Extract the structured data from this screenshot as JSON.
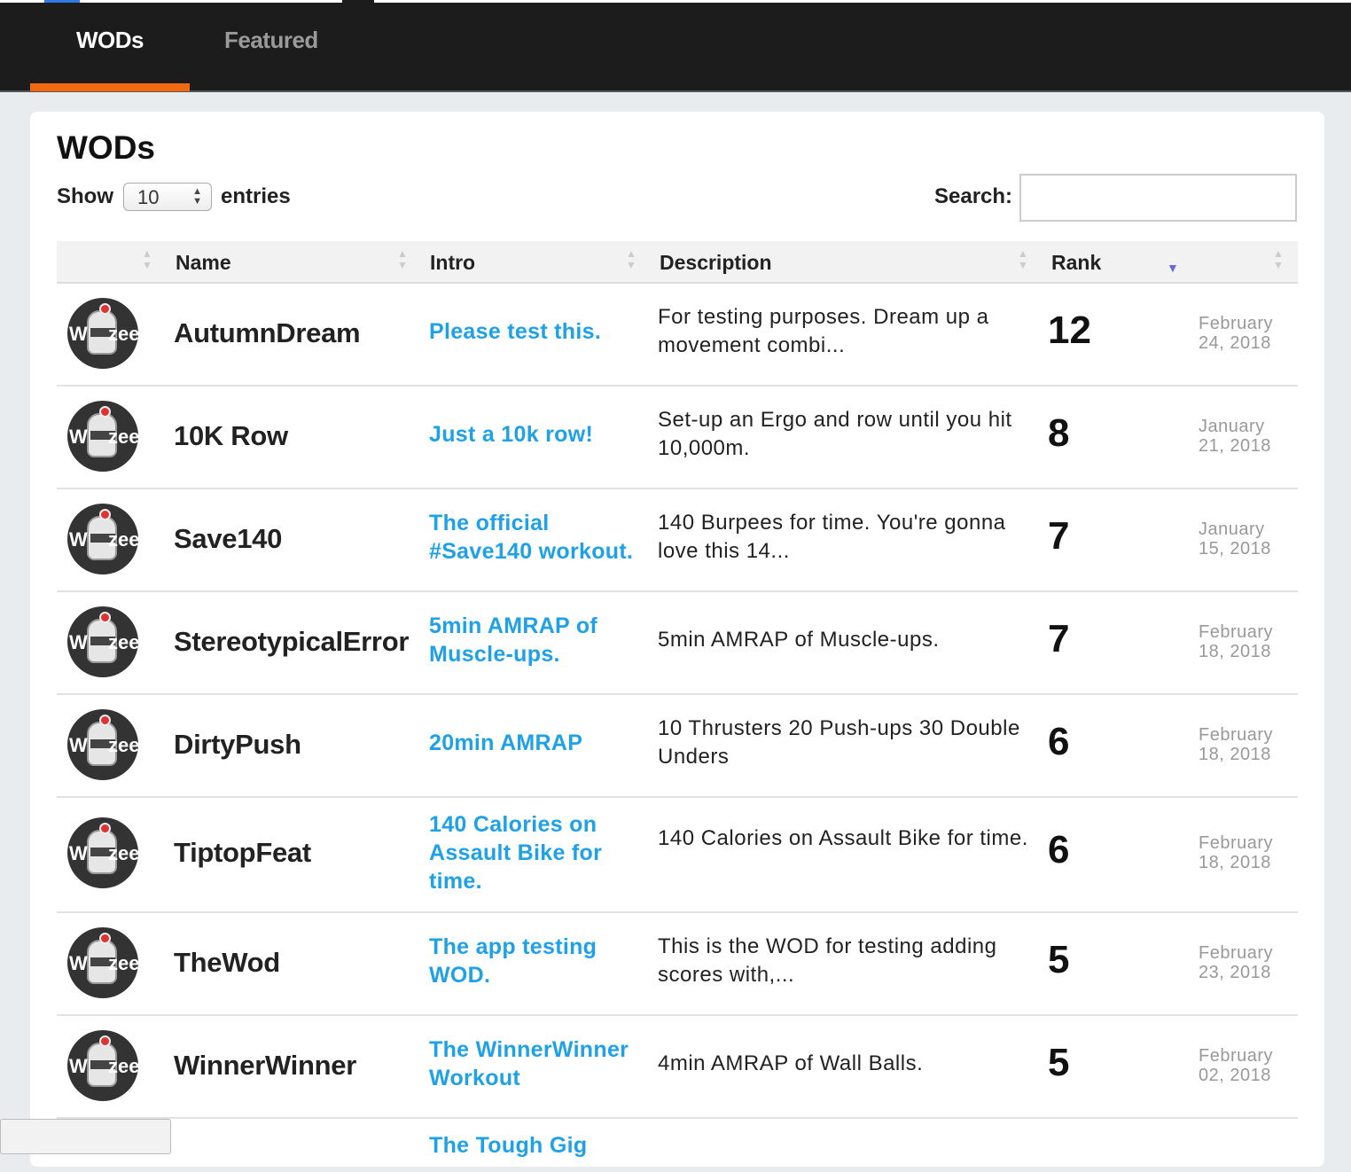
{
  "nav": {
    "tabs": [
      {
        "label": "WODs",
        "active": true
      },
      {
        "label": "Featured",
        "active": false
      }
    ],
    "accent_color": "#f26a10"
  },
  "card": {
    "title": "WODs",
    "length": {
      "show_label": "Show",
      "value": "10",
      "entries_label": "entries"
    },
    "search": {
      "label": "Search:",
      "value": ""
    }
  },
  "table": {
    "columns": [
      "",
      "Name",
      "Intro",
      "Description",
      "Rank",
      ""
    ],
    "sorted_column": "Rank",
    "sort_direction": "descending",
    "rows": [
      {
        "avatar": "robot-avatar",
        "name": "AutumnDream",
        "intro": "Please test this.",
        "description": "For testing purposes. Dream up a movement combi...",
        "rank": "12",
        "date": "February 24, 2018"
      },
      {
        "avatar": "robot-avatar",
        "name": "10K Row",
        "intro": "Just a 10k row!",
        "description": "Set-up an Ergo and row until you hit 10,000m.",
        "rank": "8",
        "date": "January 21, 2018"
      },
      {
        "avatar": "robot-avatar",
        "name": "Save140",
        "intro": "The official #Save140 workout.",
        "description": "140 Burpees for time. You're gonna love this 14...",
        "rank": "7",
        "date": "January 15, 2018"
      },
      {
        "avatar": "robot-avatar",
        "name": "StereotypicalError",
        "intro": "5min AMRAP of Muscle-ups.",
        "description": "5min AMRAP of Muscle-ups.",
        "rank": "7",
        "date": "February 18, 2018"
      },
      {
        "avatar": "robot-avatar",
        "name": "DirtyPush",
        "intro": "20min AMRAP",
        "description": "10 Thrusters 20 Push-ups 30 Double Unders",
        "rank": "6",
        "date": "February 18, 2018"
      },
      {
        "avatar": "robot-avatar",
        "name": "TiptopFeat",
        "intro": "140 Calories on Assault Bike for time.",
        "description": "140 Calories on Assault Bike for time.",
        "rank": "6",
        "date": "February 18, 2018"
      },
      {
        "avatar": "robot-avatar",
        "name": "TheWod",
        "intro": "The app testing WOD.",
        "description": "This is the WOD for testing adding scores with,...",
        "rank": "5",
        "date": "February 23, 2018"
      },
      {
        "avatar": "robot-avatar",
        "name": "WinnerWinner",
        "intro": "The WinnerWinner Workout",
        "description": "4min AMRAP of Wall Balls.",
        "rank": "5",
        "date": "February 02, 2018"
      },
      {
        "avatar": "robot-avatar",
        "name": "",
        "intro": "The Tough Gig",
        "description": "",
        "rank": "",
        "date": ""
      }
    ]
  }
}
